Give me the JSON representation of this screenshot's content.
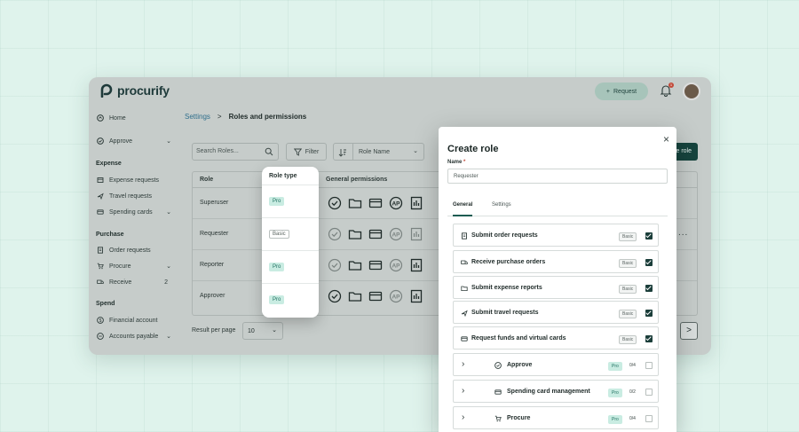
{
  "app": {
    "brand": "procurify",
    "request_button": "Request",
    "notification_count": "1"
  },
  "sidebar": {
    "home": "Home",
    "approve": "Approve",
    "sections": {
      "expense": "Expense",
      "purchase": "Purchase",
      "spend": "Spend"
    },
    "expense_items": [
      "Expense requests",
      "Travel requests",
      "Spending cards"
    ],
    "purchase_items": [
      "Order requests",
      "Procure",
      "Receive"
    ],
    "receive_count": "2",
    "spend_items": [
      "Financial account",
      "Accounts payable"
    ]
  },
  "breadcrumb": {
    "parent": "Settings",
    "separator": ">",
    "current": "Roles and permissions"
  },
  "toolbar": {
    "search_placeholder": "Search Roles...",
    "filter_label": "Filter",
    "sort_label": "Role Name",
    "add_role_fragment": "e role"
  },
  "table": {
    "headers": {
      "role": "Role",
      "role_type": "Role type",
      "general_permissions": "General permissions"
    },
    "rows": [
      {
        "name": "Superuser",
        "type": "Pro"
      },
      {
        "name": "Requester",
        "type": "Basic"
      },
      {
        "name": "Reporter",
        "type": "Pro"
      },
      {
        "name": "Approver",
        "type": "Pro"
      }
    ],
    "row_more": "..."
  },
  "pagination": {
    "result_per_page_label": "Result per page",
    "result_per_page_value": "10",
    "next": ">"
  },
  "modal": {
    "title": "Create role",
    "name_label": "Name",
    "name_required": "*",
    "name_value": "Requester",
    "tabs": [
      "General",
      "Settings"
    ],
    "permissions": [
      {
        "label": "Submit order requests",
        "badge": "Basic",
        "checked": true
      },
      {
        "label": "Receive purchase orders",
        "badge": "Basic",
        "checked": true
      },
      {
        "label": "Submit expense reports",
        "badge": "Basic",
        "checked": true
      },
      {
        "label": "Submit travel requests",
        "badge": "Basic",
        "checked": true
      },
      {
        "label": "Request funds and virtual cards",
        "badge": "Basic",
        "checked": true
      }
    ],
    "groups": [
      {
        "label": "Approve",
        "badge": "Pro",
        "count": "0/4",
        "checked": false
      },
      {
        "label": "Spending card management",
        "badge": "Pro",
        "count": "0/2",
        "checked": false
      },
      {
        "label": "Procure",
        "badge": "Pro",
        "count": "0/4",
        "checked": false
      }
    ]
  },
  "colors": {
    "background": "#dff3ec",
    "app_overlay": "#c6ccca",
    "brand_dark": "#16443e",
    "pro_badge": "#c9ece2",
    "alert": "#c24a3a"
  }
}
